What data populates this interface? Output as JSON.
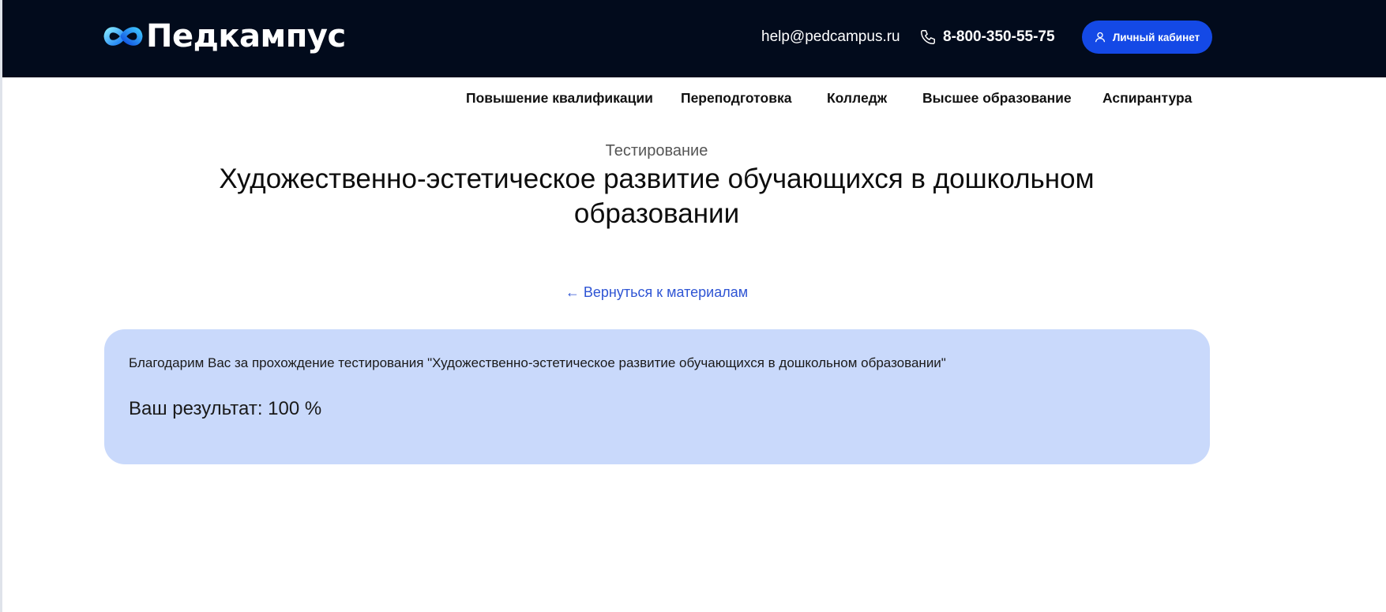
{
  "header": {
    "logo_text": "Педкампус",
    "email": "help@pedcampus.ru",
    "phone": "8-800-350-55-75",
    "cabinet_button": "Личный кабинет"
  },
  "nav": {
    "items": [
      {
        "label": "Повышение квалификации"
      },
      {
        "label": "Переподготовка"
      },
      {
        "label": "Колледж"
      },
      {
        "label": "Высшее образование"
      },
      {
        "label": "Аспирантура"
      }
    ]
  },
  "main": {
    "subtitle": "Тестирование",
    "title": "Художественно-эстетическое развитие обучающихся в дошкольном образовании",
    "back_link": "← Вернуться к материалам",
    "result_card": {
      "thanks": "Благодарим Вас за прохождение тестирования \"Художественно-эстетическое развитие обучающихся в дошкольном образовании\"",
      "result": "Ваш результат: 100 %"
    }
  },
  "icons": {
    "logo": "infinity-logo-icon",
    "phone": "phone-icon",
    "user": "user-icon"
  },
  "colors": {
    "header_bg": "#020b1c",
    "accent": "#1449e6",
    "link": "#2f55d4",
    "card_bg": "#c9d9fb"
  }
}
